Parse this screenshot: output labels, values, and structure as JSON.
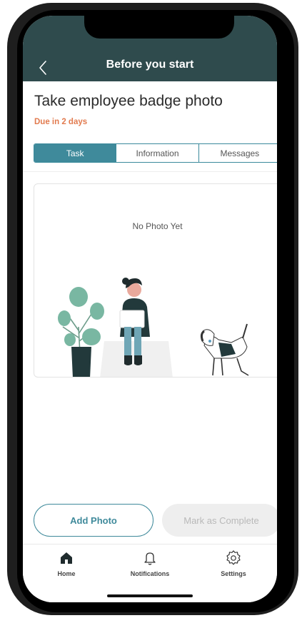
{
  "header": {
    "title": "Before you start",
    "back_icon": "chevron-left-icon"
  },
  "task": {
    "title": "Take employee badge photo",
    "due": "Due in 2 days"
  },
  "tabs": [
    {
      "label": "Task",
      "active": true
    },
    {
      "label": "Information",
      "active": false
    },
    {
      "label": "Messages",
      "active": false
    }
  ],
  "photo": {
    "empty_text": "No Photo Yet"
  },
  "actions": {
    "add_label": "Add Photo",
    "complete_label": "Mark as Complete"
  },
  "nav": [
    {
      "label": "Home",
      "icon": "home-icon"
    },
    {
      "label": "Notifications",
      "icon": "bell-icon"
    },
    {
      "label": "Settings",
      "icon": "gear-icon"
    }
  ],
  "colors": {
    "header_bg": "#2f4b4d",
    "accent": "#3f8a9b",
    "due": "#e27b4f",
    "disabled_bg": "#eeeeee"
  }
}
